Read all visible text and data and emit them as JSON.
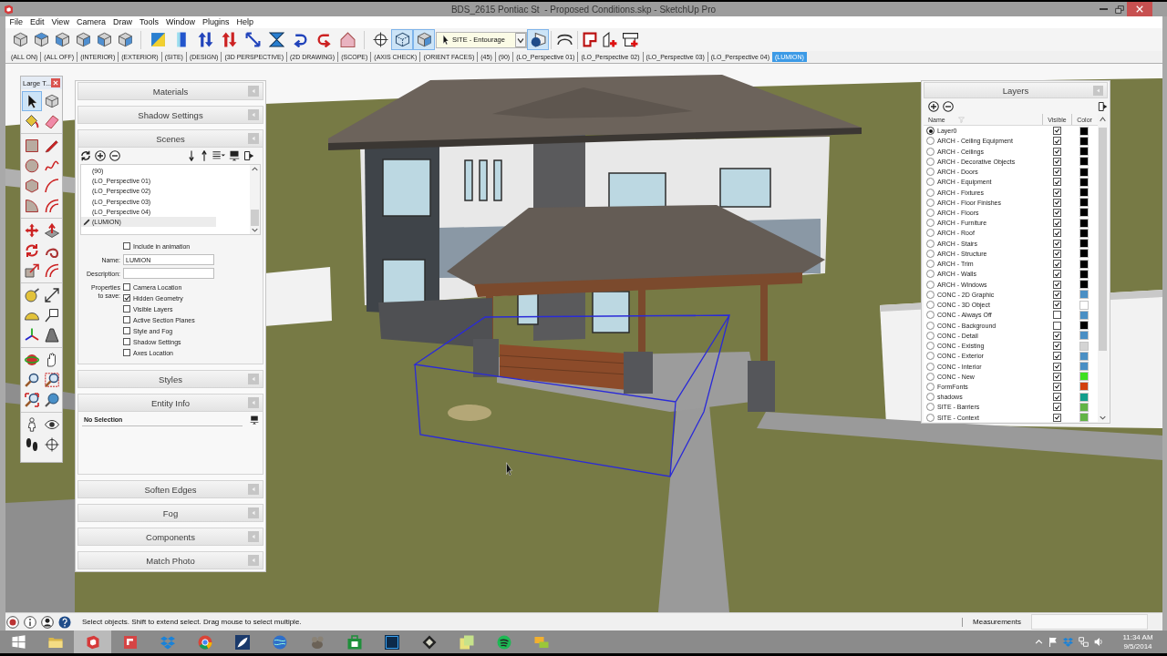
{
  "window": {
    "title": "BDS_2615 Pontiac St  - Proposed Conditions.skp - SketchUp Pro"
  },
  "menu": [
    "File",
    "Edit",
    "View",
    "Camera",
    "Draw",
    "Tools",
    "Window",
    "Plugins",
    "Help"
  ],
  "toolbar": {
    "view_buttons": [
      {
        "pressed": false
      },
      {
        "pressed": false
      },
      {
        "pressed": false
      },
      {
        "pressed": false
      },
      {
        "pressed": false
      },
      {
        "pressed": false
      }
    ],
    "edit_buttons": [
      {
        "pressed": false
      },
      {
        "pressed": false
      },
      {
        "pressed": false
      },
      {
        "pressed": false
      },
      {
        "pressed": false
      },
      {
        "pressed": false
      },
      {
        "pressed": false
      },
      {
        "pressed": false
      },
      {
        "pressed": false
      }
    ],
    "camera_buttons": [
      {
        "pressed": false
      },
      {
        "pressed": true
      },
      {
        "pressed": true
      }
    ],
    "layer_select": {
      "value": "SITE - Entourage"
    },
    "extra_buttons": [
      {
        "pressed": true
      },
      {
        "pressed": false
      },
      {
        "pressed": false
      },
      {
        "pressed": false
      },
      {
        "pressed": false
      }
    ]
  },
  "scene_tabs": [
    {
      "label": "(ALL ON)",
      "selected": false
    },
    {
      "label": "(ALL OFF)",
      "selected": false
    },
    {
      "label": "(INTERIOR)",
      "selected": false
    },
    {
      "label": "(EXTERIOR)",
      "selected": false
    },
    {
      "label": "(SITE)",
      "selected": false
    },
    {
      "label": "(DESIGN)",
      "selected": false
    },
    {
      "label": "(3D PERSPECTIVE)",
      "selected": false
    },
    {
      "label": "(2D DRAWING)",
      "selected": false
    },
    {
      "label": "(SCOPE)",
      "selected": false
    },
    {
      "label": "(AXIS CHECK)",
      "selected": false
    },
    {
      "label": "(ORIENT FACES)",
      "selected": false
    },
    {
      "label": "(45)",
      "selected": false
    },
    {
      "label": "(90)",
      "selected": false
    },
    {
      "label": "(LO_Perspective 01)",
      "selected": false
    },
    {
      "label": "(LO_Perspective 02)",
      "selected": false
    },
    {
      "label": "(LO_Perspective 03)",
      "selected": false
    },
    {
      "label": "(LO_Perspective 04)",
      "selected": false
    },
    {
      "label": "(LUMION)",
      "selected": true
    }
  ],
  "tool_palette": {
    "title": "Large T...",
    "tools": [
      {
        "selected": true
      },
      {
        "selected": false
      },
      {
        "selected": false
      },
      {
        "selected": false
      },
      {
        "selected": false
      },
      {
        "selected": false
      },
      {
        "selected": false
      },
      {
        "selected": false
      },
      {
        "selected": false
      },
      {
        "selected": false
      },
      {
        "selected": false
      },
      {
        "selected": false
      },
      {
        "selected": false
      },
      {
        "selected": false
      },
      {
        "selected": false
      },
      {
        "selected": false
      },
      {
        "selected": false
      },
      {
        "selected": false
      },
      {
        "selected": false
      },
      {
        "selected": false
      },
      {
        "selected": false
      },
      {
        "selected": false
      },
      {
        "selected": false
      },
      {
        "selected": false
      },
      {
        "selected": false
      },
      {
        "selected": false
      },
      {
        "selected": false
      },
      {
        "selected": false
      },
      {
        "selected": false
      },
      {
        "selected": false
      },
      {
        "selected": false
      },
      {
        "selected": false
      },
      {
        "selected": false
      },
      {
        "selected": false
      }
    ]
  },
  "tray": {
    "panels": [
      {
        "kind": "collapsed",
        "title": "Materials"
      },
      {
        "kind": "collapsed",
        "title": "Shadow Settings"
      },
      {
        "kind": "scenes",
        "title": "Scenes",
        "scenes": [
          {
            "label": "(90)",
            "selected": false
          },
          {
            "label": "(LO_Perspective 01)",
            "selected": false
          },
          {
            "label": "(LO_Perspective 02)",
            "selected": false
          },
          {
            "label": "(LO_Perspective 03)",
            "selected": false
          },
          {
            "label": "(LO_Perspective 04)",
            "selected": false
          },
          {
            "label": "(LUMION)",
            "selected": true
          }
        ],
        "include_in_animation": {
          "label": "Include in animation",
          "checked": false
        },
        "name_label": "Name:",
        "name_value": "LUMION",
        "description_label": "Description:",
        "properties_label": "Properties to save:",
        "properties": [
          {
            "label": "Camera Location",
            "checked": false
          },
          {
            "label": "Hidden Geometry",
            "checked": true
          },
          {
            "label": "Visible Layers",
            "checked": false
          },
          {
            "label": "Active Section Planes",
            "checked": false
          },
          {
            "label": "Style and Fog",
            "checked": false
          },
          {
            "label": "Shadow Settings",
            "checked": false
          },
          {
            "label": "Axes Location",
            "checked": false
          }
        ]
      },
      {
        "kind": "collapsed",
        "title": "Styles"
      },
      {
        "kind": "entity_info",
        "title": "Entity Info",
        "selection": "No Selection"
      },
      {
        "kind": "collapsed",
        "title": "Soften Edges"
      },
      {
        "kind": "collapsed",
        "title": "Fog"
      },
      {
        "kind": "collapsed",
        "title": "Components"
      },
      {
        "kind": "collapsed",
        "title": "Match Photo"
      }
    ]
  },
  "layers": {
    "title": "Layers",
    "columns": [
      "Name",
      "Visible",
      "Color"
    ],
    "rows": [
      {
        "name": "Layer0",
        "selected": true,
        "visible": true,
        "color": "#000000"
      },
      {
        "name": "ARCH - Ceiling Equipment",
        "selected": false,
        "visible": true,
        "color": "#000000"
      },
      {
        "name": "ARCH - Ceilings",
        "selected": false,
        "visible": true,
        "color": "#000000"
      },
      {
        "name": "ARCH - Decorative Objects",
        "selected": false,
        "visible": true,
        "color": "#000000"
      },
      {
        "name": "ARCH - Doors",
        "selected": false,
        "visible": true,
        "color": "#000000"
      },
      {
        "name": "ARCH - Equipment",
        "selected": false,
        "visible": true,
        "color": "#000000"
      },
      {
        "name": "ARCH - Fixtures",
        "selected": false,
        "visible": true,
        "color": "#000000"
      },
      {
        "name": "ARCH - Floor Finishes",
        "selected": false,
        "visible": true,
        "color": "#000000"
      },
      {
        "name": "ARCH - Floors",
        "selected": false,
        "visible": true,
        "color": "#000000"
      },
      {
        "name": "ARCH - Furniture",
        "selected": false,
        "visible": true,
        "color": "#000000"
      },
      {
        "name": "ARCH - Roof",
        "selected": false,
        "visible": true,
        "color": "#000000"
      },
      {
        "name": "ARCH - Stairs",
        "selected": false,
        "visible": true,
        "color": "#000000"
      },
      {
        "name": "ARCH - Structure",
        "selected": false,
        "visible": true,
        "color": "#000000"
      },
      {
        "name": "ARCH - Trim",
        "selected": false,
        "visible": true,
        "color": "#000000"
      },
      {
        "name": "ARCH - Walls",
        "selected": false,
        "visible": true,
        "color": "#000000"
      },
      {
        "name": "ARCH - Windows",
        "selected": false,
        "visible": true,
        "color": "#000000"
      },
      {
        "name": "CONC - 2D Graphic",
        "selected": false,
        "visible": true,
        "color": "#4a8fc4"
      },
      {
        "name": "CONC - 3D Object",
        "selected": false,
        "visible": true,
        "color": "#ffffff"
      },
      {
        "name": "CONC - Always Off",
        "selected": false,
        "visible": false,
        "color": "#4a8fc4"
      },
      {
        "name": "CONC - Background",
        "selected": false,
        "visible": false,
        "color": "#000000"
      },
      {
        "name": "CONC - Detail",
        "selected": false,
        "visible": true,
        "color": "#4a8fc4"
      },
      {
        "name": "CONC - Existing",
        "selected": false,
        "visible": true,
        "color": "#d4d4d4"
      },
      {
        "name": "CONC - Exterior",
        "selected": false,
        "visible": true,
        "color": "#4a8fc4"
      },
      {
        "name": "CONC - Interior",
        "selected": false,
        "visible": true,
        "color": "#4a8fc4"
      },
      {
        "name": "CONC - New",
        "selected": false,
        "visible": true,
        "color": "#3ee020"
      },
      {
        "name": "FormFonts",
        "selected": false,
        "visible": true,
        "color": "#d2400e"
      },
      {
        "name": "shadows",
        "selected": false,
        "visible": true,
        "color": "#129e8c"
      },
      {
        "name": "SITE - Barriers",
        "selected": false,
        "visible": true,
        "color": "#62b446"
      },
      {
        "name": "SITE - Context",
        "selected": false,
        "visible": true,
        "color": "#62b446"
      }
    ]
  },
  "status_bar": {
    "hint": "Select objects. Shift to extend select. Drag mouse to select multiple.",
    "measurements_label": "Measurements"
  },
  "taskbar": {
    "apps": [
      {
        "active": false
      },
      {
        "active": true
      },
      {
        "active": false
      },
      {
        "active": false
      },
      {
        "active": false
      },
      {
        "active": false
      },
      {
        "active": false
      },
      {
        "active": false
      },
      {
        "active": false
      },
      {
        "active": false
      },
      {
        "active": false
      },
      {
        "active": false
      },
      {
        "active": false
      },
      {
        "active": false
      }
    ],
    "clock": {
      "time": "11:34 AM",
      "date": "9/5/2014"
    }
  }
}
